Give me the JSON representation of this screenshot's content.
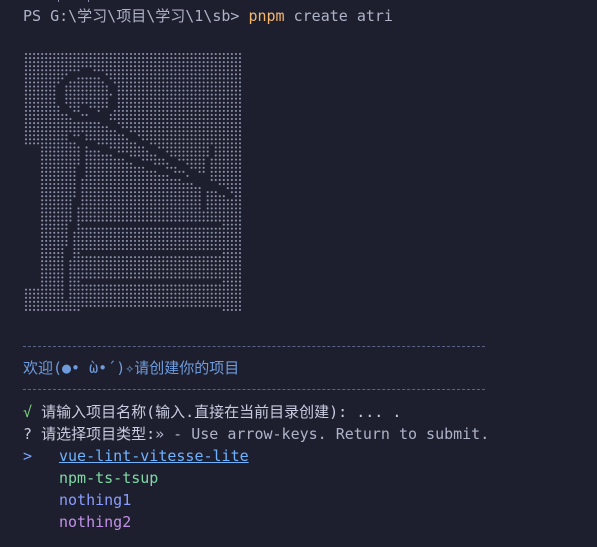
{
  "terminal": {
    "prompt": "PS G:\\学习\\项目\\学习\\1\\sb>",
    "command": "pnpm",
    "args": "create atri"
  },
  "banner": {
    "divider": "------------------------------------------------------",
    "welcome": "欢迎(●• ὼ•´)✧请创建你的项目"
  },
  "prompts": {
    "answered": {
      "symbol": "√",
      "question": "请输入项目名称(输入.直接在当前目录创建):",
      "answer": "... ."
    },
    "active": {
      "symbol": "?",
      "question": "请选择项目类型:",
      "hint": "» - Use arrow-keys. Return to submit."
    }
  },
  "options": {
    "pointer": ">",
    "items": [
      {
        "label": "vue-lint-vitesse-lite",
        "color": "#6fb3ff",
        "selected": true
      },
      {
        "label": "npm-ts-tsup",
        "color": "#7fd9a5"
      },
      {
        "label": "nothing1",
        "color": "#8a9cff"
      },
      {
        "label": "nothing2",
        "color": "#c391e8"
      }
    ]
  }
}
